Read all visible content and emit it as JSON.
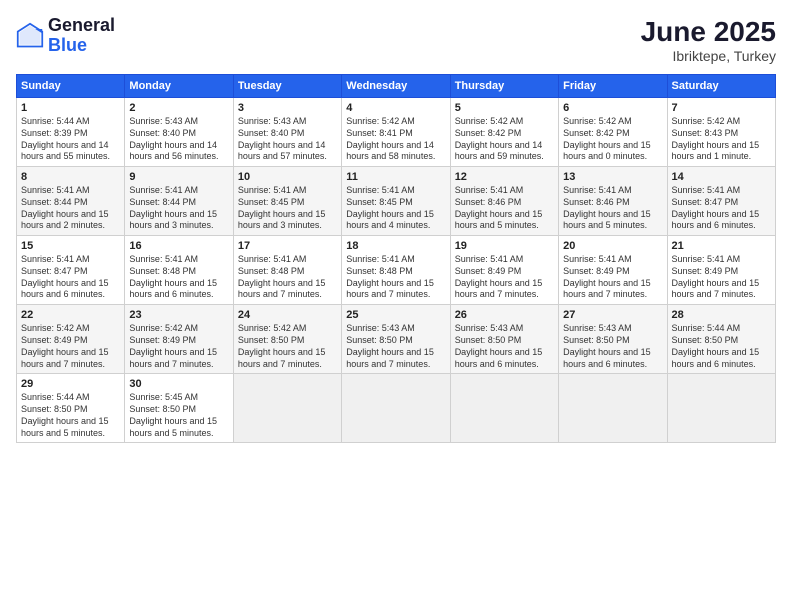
{
  "header": {
    "logo_general": "General",
    "logo_blue": "Blue",
    "month_year": "June 2025",
    "location": "Ibriktepe, Turkey"
  },
  "calendar": {
    "days_of_week": [
      "Sunday",
      "Monday",
      "Tuesday",
      "Wednesday",
      "Thursday",
      "Friday",
      "Saturday"
    ],
    "weeks": [
      [
        {
          "day": "",
          "empty": true
        },
        {
          "day": "",
          "empty": true
        },
        {
          "day": "",
          "empty": true
        },
        {
          "day": "",
          "empty": true
        },
        {
          "day": "",
          "empty": true
        },
        {
          "day": "",
          "empty": true
        },
        {
          "day": "",
          "empty": true
        }
      ],
      [
        {
          "num": "1",
          "sunrise": "5:44 AM",
          "sunset": "8:39 PM",
          "daylight": "14 hours and 55 minutes."
        },
        {
          "num": "2",
          "sunrise": "5:43 AM",
          "sunset": "8:40 PM",
          "daylight": "14 hours and 56 minutes."
        },
        {
          "num": "3",
          "sunrise": "5:43 AM",
          "sunset": "8:40 PM",
          "daylight": "14 hours and 57 minutes."
        },
        {
          "num": "4",
          "sunrise": "5:42 AM",
          "sunset": "8:41 PM",
          "daylight": "14 hours and 58 minutes."
        },
        {
          "num": "5",
          "sunrise": "5:42 AM",
          "sunset": "8:42 PM",
          "daylight": "14 hours and 59 minutes."
        },
        {
          "num": "6",
          "sunrise": "5:42 AM",
          "sunset": "8:42 PM",
          "daylight": "15 hours and 0 minutes."
        },
        {
          "num": "7",
          "sunrise": "5:42 AM",
          "sunset": "8:43 PM",
          "daylight": "15 hours and 1 minute."
        }
      ],
      [
        {
          "num": "8",
          "sunrise": "5:41 AM",
          "sunset": "8:44 PM",
          "daylight": "15 hours and 2 minutes."
        },
        {
          "num": "9",
          "sunrise": "5:41 AM",
          "sunset": "8:44 PM",
          "daylight": "15 hours and 3 minutes."
        },
        {
          "num": "10",
          "sunrise": "5:41 AM",
          "sunset": "8:45 PM",
          "daylight": "15 hours and 3 minutes."
        },
        {
          "num": "11",
          "sunrise": "5:41 AM",
          "sunset": "8:45 PM",
          "daylight": "15 hours and 4 minutes."
        },
        {
          "num": "12",
          "sunrise": "5:41 AM",
          "sunset": "8:46 PM",
          "daylight": "15 hours and 5 minutes."
        },
        {
          "num": "13",
          "sunrise": "5:41 AM",
          "sunset": "8:46 PM",
          "daylight": "15 hours and 5 minutes."
        },
        {
          "num": "14",
          "sunrise": "5:41 AM",
          "sunset": "8:47 PM",
          "daylight": "15 hours and 6 minutes."
        }
      ],
      [
        {
          "num": "15",
          "sunrise": "5:41 AM",
          "sunset": "8:47 PM",
          "daylight": "15 hours and 6 minutes."
        },
        {
          "num": "16",
          "sunrise": "5:41 AM",
          "sunset": "8:48 PM",
          "daylight": "15 hours and 6 minutes."
        },
        {
          "num": "17",
          "sunrise": "5:41 AM",
          "sunset": "8:48 PM",
          "daylight": "15 hours and 7 minutes."
        },
        {
          "num": "18",
          "sunrise": "5:41 AM",
          "sunset": "8:48 PM",
          "daylight": "15 hours and 7 minutes."
        },
        {
          "num": "19",
          "sunrise": "5:41 AM",
          "sunset": "8:49 PM",
          "daylight": "15 hours and 7 minutes."
        },
        {
          "num": "20",
          "sunrise": "5:41 AM",
          "sunset": "8:49 PM",
          "daylight": "15 hours and 7 minutes."
        },
        {
          "num": "21",
          "sunrise": "5:41 AM",
          "sunset": "8:49 PM",
          "daylight": "15 hours and 7 minutes."
        }
      ],
      [
        {
          "num": "22",
          "sunrise": "5:42 AM",
          "sunset": "8:49 PM",
          "daylight": "15 hours and 7 minutes."
        },
        {
          "num": "23",
          "sunrise": "5:42 AM",
          "sunset": "8:49 PM",
          "daylight": "15 hours and 7 minutes."
        },
        {
          "num": "24",
          "sunrise": "5:42 AM",
          "sunset": "8:50 PM",
          "daylight": "15 hours and 7 minutes."
        },
        {
          "num": "25",
          "sunrise": "5:43 AM",
          "sunset": "8:50 PM",
          "daylight": "15 hours and 7 minutes."
        },
        {
          "num": "26",
          "sunrise": "5:43 AM",
          "sunset": "8:50 PM",
          "daylight": "15 hours and 6 minutes."
        },
        {
          "num": "27",
          "sunrise": "5:43 AM",
          "sunset": "8:50 PM",
          "daylight": "15 hours and 6 minutes."
        },
        {
          "num": "28",
          "sunrise": "5:44 AM",
          "sunset": "8:50 PM",
          "daylight": "15 hours and 6 minutes."
        }
      ],
      [
        {
          "num": "29",
          "sunrise": "5:44 AM",
          "sunset": "8:50 PM",
          "daylight": "15 hours and 5 minutes."
        },
        {
          "num": "30",
          "sunrise": "5:45 AM",
          "sunset": "8:50 PM",
          "daylight": "15 hours and 5 minutes."
        },
        {
          "day": "",
          "empty": true
        },
        {
          "day": "",
          "empty": true
        },
        {
          "day": "",
          "empty": true
        },
        {
          "day": "",
          "empty": true
        },
        {
          "day": "",
          "empty": true
        }
      ]
    ]
  }
}
